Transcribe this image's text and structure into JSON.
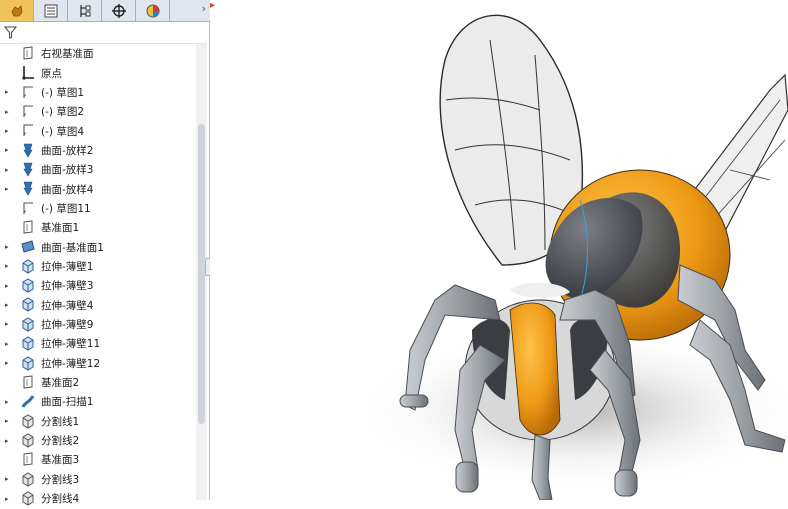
{
  "feature_tree": {
    "tabs": [
      {
        "icon": "feature-manager-icon",
        "active": true
      },
      {
        "icon": "property-manager-icon",
        "active": false
      },
      {
        "icon": "configuration-manager-icon",
        "active": false
      },
      {
        "icon": "dimxpert-icon",
        "active": false
      },
      {
        "icon": "display-manager-icon",
        "active": false
      }
    ],
    "more_icon": "chevron-right-icon",
    "filter_icon": "filter-icon",
    "items": [
      {
        "label": "右视基准面",
        "icon": "plane-icon",
        "expandable": false
      },
      {
        "label": "原点",
        "icon": "origin-icon",
        "expandable": false
      },
      {
        "label": "(-) 草图1",
        "icon": "sketch-icon",
        "expandable": true
      },
      {
        "label": "(-) 草图2",
        "icon": "sketch-icon",
        "expandable": true
      },
      {
        "label": "(-) 草图4",
        "icon": "sketch-icon",
        "expandable": true
      },
      {
        "label": "曲面-放样2",
        "icon": "surface-loft-icon",
        "expandable": true
      },
      {
        "label": "曲面-放样3",
        "icon": "surface-loft-icon",
        "expandable": true
      },
      {
        "label": "曲面-放样4",
        "icon": "surface-loft-icon",
        "expandable": true
      },
      {
        "label": "(-) 草图11",
        "icon": "sketch-icon",
        "expandable": false
      },
      {
        "label": "基准面1",
        "icon": "plane-icon",
        "expandable": false
      },
      {
        "label": "曲面-基准面1",
        "icon": "planar-surface-icon",
        "expandable": true
      },
      {
        "label": "拉伸-薄壁1",
        "icon": "extrude-thin-icon",
        "expandable": true
      },
      {
        "label": "拉伸-薄壁3",
        "icon": "extrude-thin-icon",
        "expandable": true
      },
      {
        "label": "拉伸-薄壁4",
        "icon": "extrude-thin-icon",
        "expandable": true
      },
      {
        "label": "拉伸-薄壁9",
        "icon": "extrude-thin-icon",
        "expandable": true
      },
      {
        "label": "拉伸-薄壁11",
        "icon": "extrude-thin-icon",
        "expandable": true
      },
      {
        "label": "拉伸-薄壁12",
        "icon": "extrude-thin-icon",
        "expandable": true
      },
      {
        "label": "基准面2",
        "icon": "plane-icon",
        "expandable": false
      },
      {
        "label": "曲面-扫描1",
        "icon": "surface-sweep-icon",
        "expandable": true
      },
      {
        "label": "分割线1",
        "icon": "split-line-icon",
        "expandable": true
      },
      {
        "label": "分割线2",
        "icon": "split-line-icon",
        "expandable": true
      },
      {
        "label": "基准面3",
        "icon": "plane-icon",
        "expandable": false
      },
      {
        "label": "分割线3",
        "icon": "split-line-icon",
        "expandable": true
      },
      {
        "label": "分割线4",
        "icon": "split-line-icon",
        "expandable": true
      }
    ]
  },
  "viewport": {
    "model": "bee-3d-model",
    "colors": {
      "body_orange": "#ee9a16",
      "body_dark": "#4a4d52",
      "leg_gray": "#9ea3a8",
      "wing": "#ececec",
      "shadow": "#c9c9c9",
      "accent": "#f3c35b"
    }
  }
}
